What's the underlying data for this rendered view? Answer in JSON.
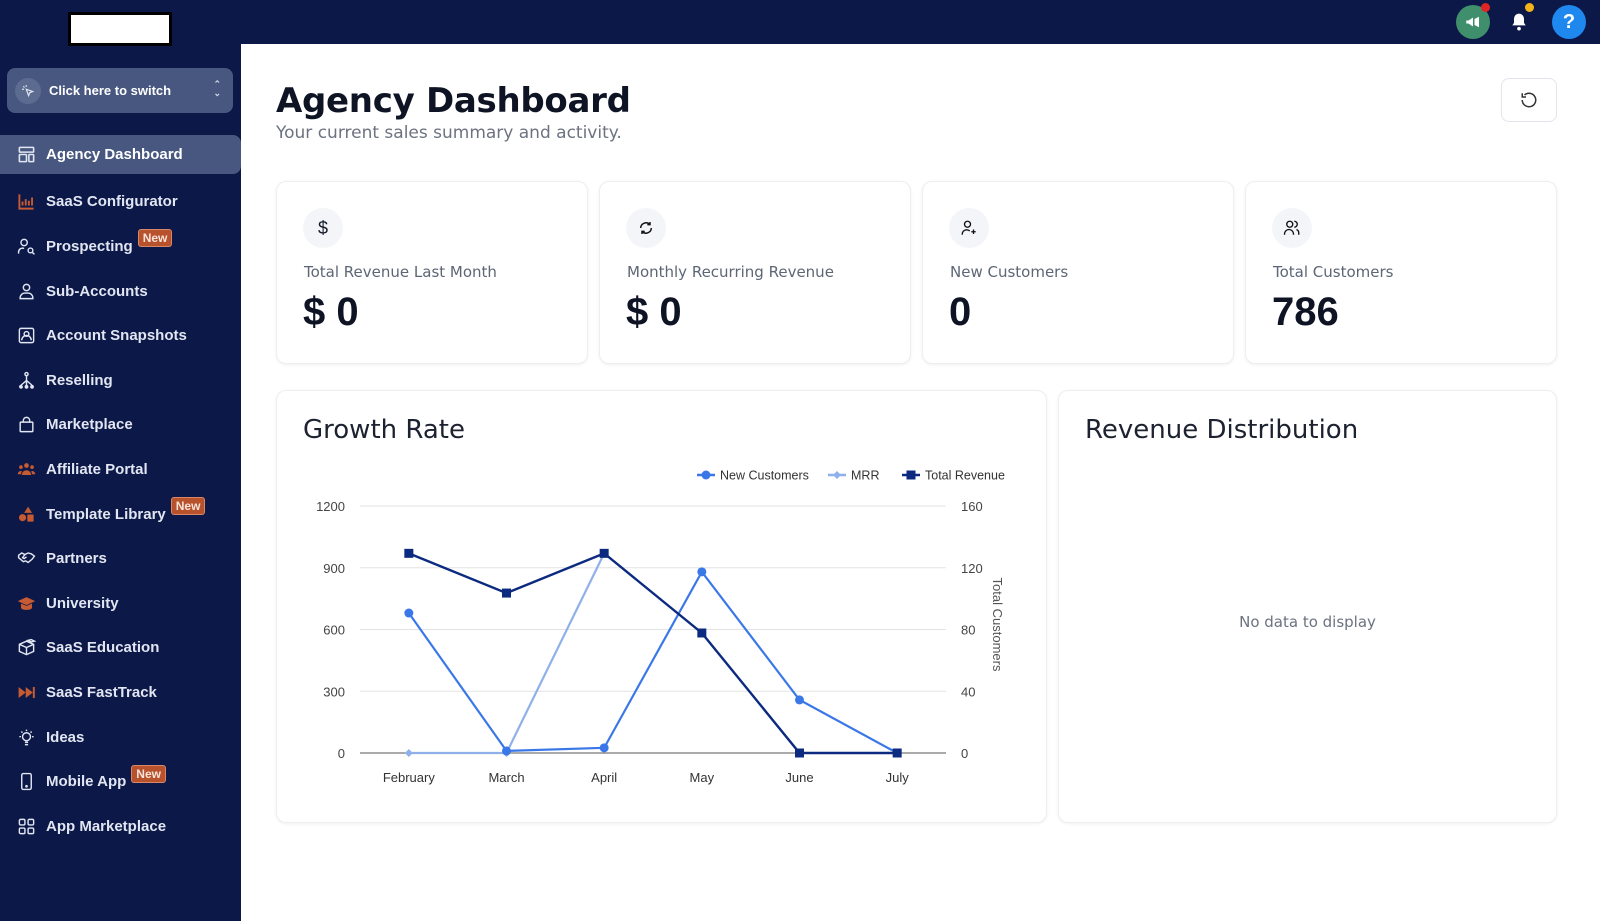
{
  "app": {
    "switcher_label": "Click here to switch"
  },
  "sidebar": {
    "items": [
      {
        "label": "Agency Dashboard",
        "icon": "dashboard-icon",
        "active": true
      },
      {
        "label": "SaaS Configurator",
        "icon": "bar-chart-icon",
        "accent": true
      },
      {
        "label": "Prospecting",
        "icon": "user-search-icon",
        "badge": "New"
      },
      {
        "label": "Sub-Accounts",
        "icon": "user-icon"
      },
      {
        "label": "Account Snapshots",
        "icon": "snapshot-icon"
      },
      {
        "label": "Reselling",
        "icon": "hierarchy-icon"
      },
      {
        "label": "Marketplace",
        "icon": "shopping-bag-icon"
      },
      {
        "label": "Affiliate Portal",
        "icon": "users-group-icon",
        "accent": true
      },
      {
        "label": "Template Library",
        "icon": "shapes-icon",
        "accent": true,
        "badge": "New"
      },
      {
        "label": "Partners",
        "icon": "handshake-icon"
      },
      {
        "label": "University",
        "icon": "graduation-cap-icon",
        "accent": true
      },
      {
        "label": "SaaS Education",
        "icon": "box-education-icon"
      },
      {
        "label": "SaaS FastTrack",
        "icon": "fast-forward-icon",
        "accent": true
      },
      {
        "label": "Ideas",
        "icon": "lightbulb-icon"
      },
      {
        "label": "Mobile App",
        "icon": "mobile-icon",
        "badge": "New"
      },
      {
        "label": "App Marketplace",
        "icon": "apps-grid-icon"
      }
    ]
  },
  "topbar": {
    "help_label": "?",
    "colors": {
      "announce": "#3f8f6d",
      "announce_dot": "#e02424",
      "bell_dot": "#f5b31a",
      "help": "#1e88ef"
    }
  },
  "header": {
    "title": "Agency Dashboard",
    "subtitle": "Your current sales summary and activity."
  },
  "stats": [
    {
      "label": "Total Revenue Last Month",
      "value": "$ 0",
      "icon": "dollar-icon"
    },
    {
      "label": "Monthly Recurring Revenue",
      "value": "$ 0",
      "icon": "refresh-cycle-icon"
    },
    {
      "label": "New Customers",
      "value": "0",
      "icon": "user-plus-icon"
    },
    {
      "label": "Total Customers",
      "value": "786",
      "icon": "users-icon"
    }
  ],
  "growth": {
    "title": "Growth Rate"
  },
  "distribution": {
    "title": "Revenue Distribution",
    "empty_text": "No data to display"
  },
  "chart_data": {
    "type": "line",
    "title": "Growth Rate",
    "categories": [
      "February",
      "March",
      "April",
      "May",
      "June",
      "July"
    ],
    "series": [
      {
        "name": "New Customers",
        "marker": "circle",
        "color": "#3b78e7",
        "axis": "left",
        "values": [
          680,
          10,
          25,
          880,
          258,
          0
        ]
      },
      {
        "name": "MRR",
        "marker": "diamond",
        "color": "#8fb0ea",
        "axis": "left",
        "values": [
          0,
          0,
          970,
          null,
          null,
          null
        ]
      },
      {
        "name": "Total Revenue",
        "marker": "square",
        "color": "#0b2a80",
        "axis": "left",
        "values": [
          970,
          777,
          970,
          583,
          0,
          0
        ]
      }
    ],
    "left_axis": {
      "ticks": [
        "0",
        "300",
        "600",
        "900",
        "1200"
      ],
      "ylim": [
        0,
        1200
      ]
    },
    "right_axis": {
      "label": "Total Customers",
      "ticks": [
        "0",
        "40",
        "80",
        "120",
        "160"
      ],
      "ylim": [
        0,
        160
      ]
    },
    "grid": true,
    "legend_position": "top-right"
  }
}
